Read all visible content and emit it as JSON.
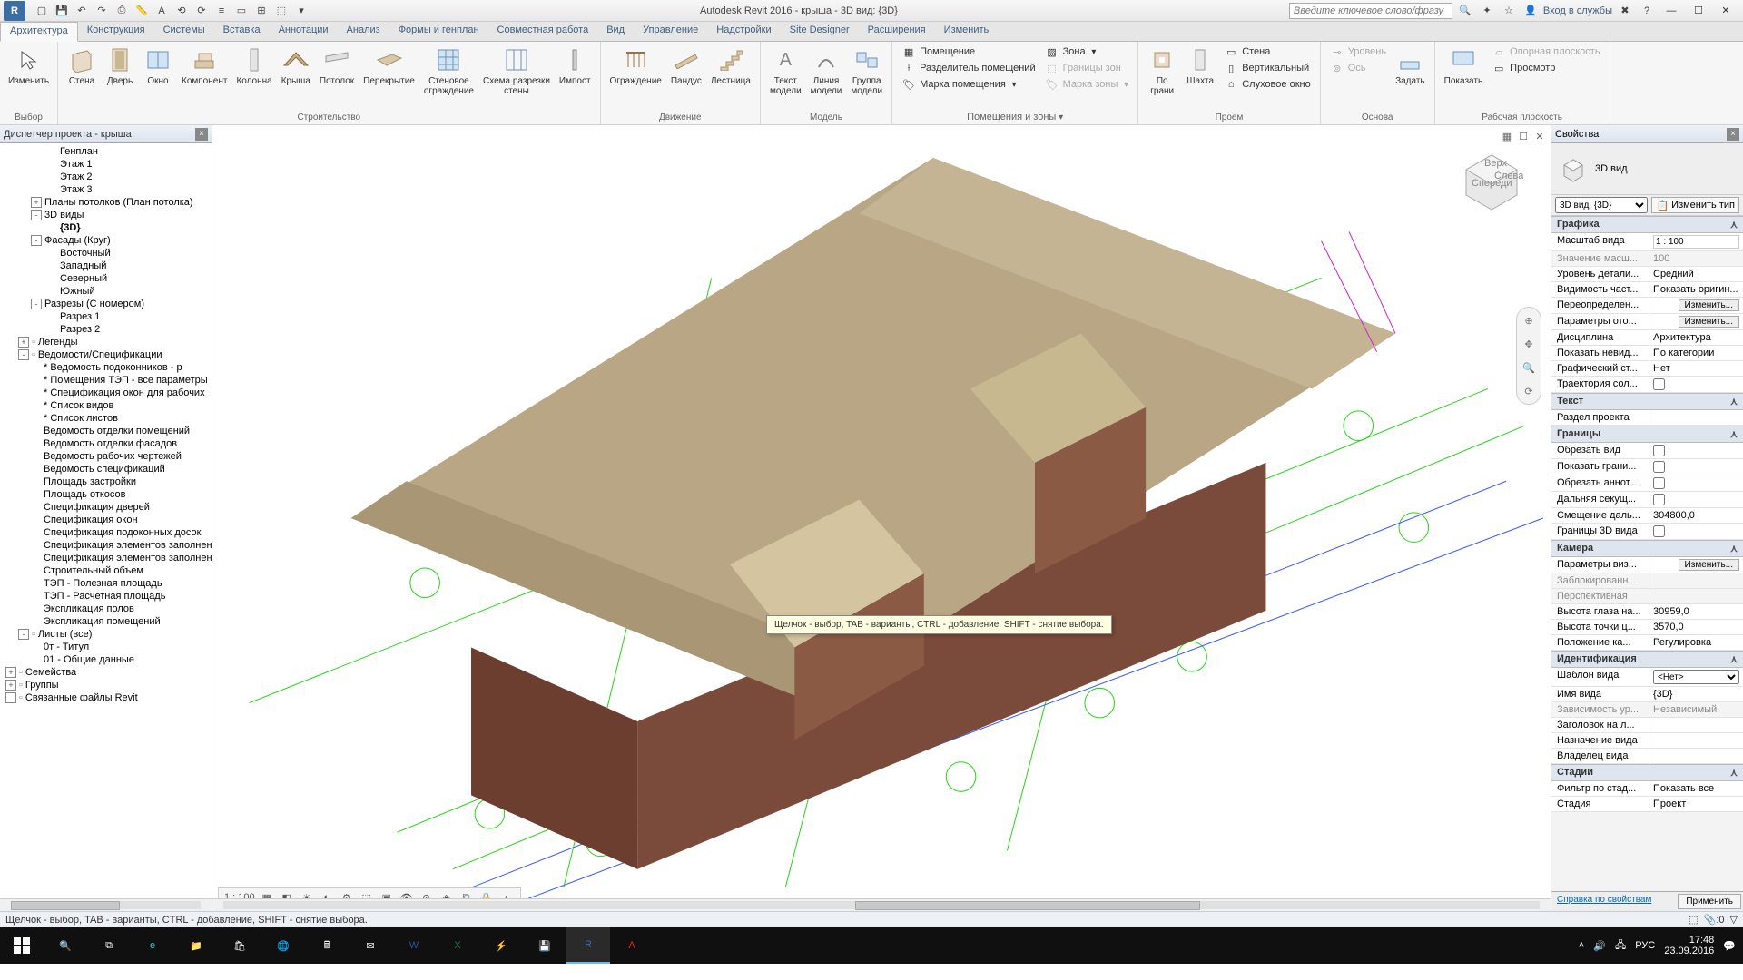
{
  "title": "Autodesk Revit 2016 -     крыша - 3D вид: {3D}",
  "search_placeholder": "Введите ключевое слово/фразу",
  "signin": "Вход в службы",
  "tabs": [
    "Архитектура",
    "Конструкция",
    "Системы",
    "Вставка",
    "Аннотации",
    "Анализ",
    "Формы и генплан",
    "Совместная работа",
    "Вид",
    "Управление",
    "Надстройки",
    "Site Designer",
    "Расширения",
    "Изменить"
  ],
  "panels": {
    "select": {
      "title": "Выбор",
      "modify": "Изменить"
    },
    "build": {
      "title": "Строительство",
      "wall": "Стена",
      "door": "Дверь",
      "window": "Окно",
      "component": "Компонент",
      "column": "Колонна",
      "roof": "Крыша",
      "ceiling": "Потолок",
      "floor": "Перекрытие",
      "curtain": "Стеновое\nограждение",
      "grid": "Схема разрезки\nстены",
      "mullion": "Импост"
    },
    "circ": {
      "title": "Движение",
      "rail": "Ограждение",
      "ramp": "Пандус",
      "stair": "Лестница"
    },
    "model": {
      "title": "Модель",
      "mtext": "Текст\nмодели",
      "mline": "Линия\nмодели",
      "mgroup": "Группа\nмодели"
    },
    "room": {
      "title": "Помещения и зоны",
      "room": "Помещение",
      "sep": "Разделитель помещений",
      "tag": "Марка помещения",
      "area": "Зона",
      "abound": "Границы  зон",
      "atag": "Марка  зоны"
    },
    "open": {
      "title": "Проем",
      "byface": "По\nграни",
      "shaft": "Шахта",
      "owall": "Стена",
      "vert": "Вертикальный",
      "dormer": "Слуховое окно"
    },
    "datum": {
      "title": "Основа",
      "level": "Уровень",
      "grid": "Ось",
      "set": "Задать"
    },
    "wp": {
      "title": "Рабочая плоскость",
      "show": "Показать",
      "ref": "Опорная плоскость",
      "viewer": "Просмотр"
    }
  },
  "browser": {
    "title": "Диспетчер проекта - крыша",
    "items": [
      {
        "t": "Генплан",
        "i": 66
      },
      {
        "t": "Этаж 1",
        "i": 66
      },
      {
        "t": "Этаж 2",
        "i": 66
      },
      {
        "t": "Этаж 3",
        "i": 66
      },
      {
        "t": "Планы потолков (План потолка)",
        "i": 34,
        "exp": "+"
      },
      {
        "t": "3D виды",
        "i": 34,
        "exp": "-"
      },
      {
        "t": "{3D}",
        "i": 66,
        "sel": true
      },
      {
        "t": "Фасады (Круг)",
        "i": 34,
        "exp": "-"
      },
      {
        "t": "Восточный",
        "i": 66
      },
      {
        "t": "Западный",
        "i": 66
      },
      {
        "t": "Северный",
        "i": 66
      },
      {
        "t": "Южный",
        "i": 66
      },
      {
        "t": "Разрезы (С номером)",
        "i": 34,
        "exp": "-"
      },
      {
        "t": "Разрез 1",
        "i": 66
      },
      {
        "t": "Разрез 2",
        "i": 66
      },
      {
        "t": "Легенды",
        "i": 20,
        "exp": "+",
        "ic": "L"
      },
      {
        "t": "Ведомости/Спецификации",
        "i": 20,
        "exp": "-",
        "ic": "S"
      },
      {
        "t": "* Ведомость подоконников - р",
        "i": 48
      },
      {
        "t": "* Помещения ТЭП - все параметры",
        "i": 48
      },
      {
        "t": "* Спецификация окон для рабочих",
        "i": 48
      },
      {
        "t": "* Список видов",
        "i": 48
      },
      {
        "t": "* Список листов",
        "i": 48
      },
      {
        "t": "Ведомость отделки помещений",
        "i": 48
      },
      {
        "t": "Ведомость отделки фасадов",
        "i": 48
      },
      {
        "t": "Ведомость рабочих чертежей",
        "i": 48
      },
      {
        "t": "Ведомость спецификаций",
        "i": 48
      },
      {
        "t": "Площадь застройки",
        "i": 48
      },
      {
        "t": "Площадь откосов",
        "i": 48
      },
      {
        "t": "Спецификация дверей",
        "i": 48
      },
      {
        "t": "Спецификация окон",
        "i": 48
      },
      {
        "t": "Спецификация подоконных досок",
        "i": 48
      },
      {
        "t": "Спецификация элементов заполнения",
        "i": 48
      },
      {
        "t": "Спецификация элементов заполнения",
        "i": 48
      },
      {
        "t": "Строительный объем",
        "i": 48
      },
      {
        "t": "ТЭП - Полезная площадь",
        "i": 48
      },
      {
        "t": "ТЭП - Расчетная площадь",
        "i": 48
      },
      {
        "t": "Экспликация полов",
        "i": 48
      },
      {
        "t": "Экспликация помещений",
        "i": 48
      },
      {
        "t": "Листы (все)",
        "i": 20,
        "exp": "-",
        "ic": "Sh"
      },
      {
        "t": "0т - Титул",
        "i": 48
      },
      {
        "t": "01 - Общие данные",
        "i": 48
      },
      {
        "t": "Семейства",
        "i": 6,
        "exp": "+",
        "ic": "F"
      },
      {
        "t": "Группы",
        "i": 6,
        "exp": "+",
        "ic": "G"
      },
      {
        "t": "Связанные файлы Revit",
        "i": 6,
        "exp": "",
        "ic": "R"
      }
    ]
  },
  "viewctrl": {
    "scale": "1 : 100"
  },
  "tooltip": "Щелчок - выбор, TAB - варианты, CTRL - добавление, SHIFT - снятие выбора.",
  "props": {
    "title": "Свойства",
    "type": "3D вид",
    "instance": "3D вид: {3D}",
    "edit_type": "Изменить тип",
    "cats": [
      {
        "n": "Графика",
        "rows": [
          {
            "k": "Масштаб вида",
            "v": "1 : 100",
            "ctl": "text"
          },
          {
            "k": "Значение масш...",
            "v": "100",
            "dis": true
          },
          {
            "k": "Уровень детали...",
            "v": "Средний"
          },
          {
            "k": "Видимость част...",
            "v": "Показать оригин..."
          },
          {
            "k": "Переопределен...",
            "v": "Изменить...",
            "ctl": "btn"
          },
          {
            "k": "Параметры ото...",
            "v": "Изменить...",
            "ctl": "btn"
          },
          {
            "k": "Дисциплина",
            "v": "Архитектура"
          },
          {
            "k": "Показать невид...",
            "v": "По категории"
          },
          {
            "k": "Графический ст...",
            "v": "Нет"
          },
          {
            "k": "Траектория сол...",
            "v": "",
            "ctl": "chk"
          }
        ]
      },
      {
        "n": "Текст",
        "rows": [
          {
            "k": "Раздел проекта",
            "v": ""
          }
        ]
      },
      {
        "n": "Границы",
        "rows": [
          {
            "k": "Обрезать вид",
            "v": "",
            "ctl": "chk"
          },
          {
            "k": "Показать грани...",
            "v": "",
            "ctl": "chk"
          },
          {
            "k": "Обрезать аннот...",
            "v": "",
            "ctl": "chk"
          },
          {
            "k": "Дальняя секущ...",
            "v": "",
            "ctl": "chk"
          },
          {
            "k": "Смещение даль...",
            "v": "304800,0"
          },
          {
            "k": "Границы 3D вида",
            "v": "",
            "ctl": "chk"
          }
        ]
      },
      {
        "n": "Камера",
        "rows": [
          {
            "k": "Параметры виз...",
            "v": "Изменить...",
            "ctl": "btn"
          },
          {
            "k": "Заблокированн...",
            "v": "",
            "dis": true
          },
          {
            "k": "Перспективная",
            "v": "",
            "dis": true
          },
          {
            "k": "Высота глаза на...",
            "v": "30959,0"
          },
          {
            "k": "Высота точки ц...",
            "v": "3570,0"
          },
          {
            "k": "Положение ка...",
            "v": "Регулировка"
          }
        ]
      },
      {
        "n": "Идентификация",
        "rows": [
          {
            "k": "Шаблон вида",
            "v": "<Нет>",
            "ctl": "sel"
          },
          {
            "k": "Имя вида",
            "v": "{3D}"
          },
          {
            "k": "Зависимость ур...",
            "v": "Независимый",
            "dis": true
          },
          {
            "k": "Заголовок на л...",
            "v": ""
          },
          {
            "k": "Назначение вида",
            "v": ""
          },
          {
            "k": "Владелец вида",
            "v": ""
          }
        ]
      },
      {
        "n": "Стадии",
        "rows": [
          {
            "k": "Фильтр по стад...",
            "v": "Показать все"
          },
          {
            "k": "Стадия",
            "v": "Проект"
          }
        ]
      }
    ],
    "help": "Справка по свойствам",
    "apply": "Применить"
  },
  "status": "Щелчок - выбор, TAB - варианты, CTRL - добавление, SHIFT - снятие выбора.",
  "status_right": "0",
  "tray": {
    "lang": "РУС",
    "time": "17:48",
    "date": "23.09.2016"
  }
}
